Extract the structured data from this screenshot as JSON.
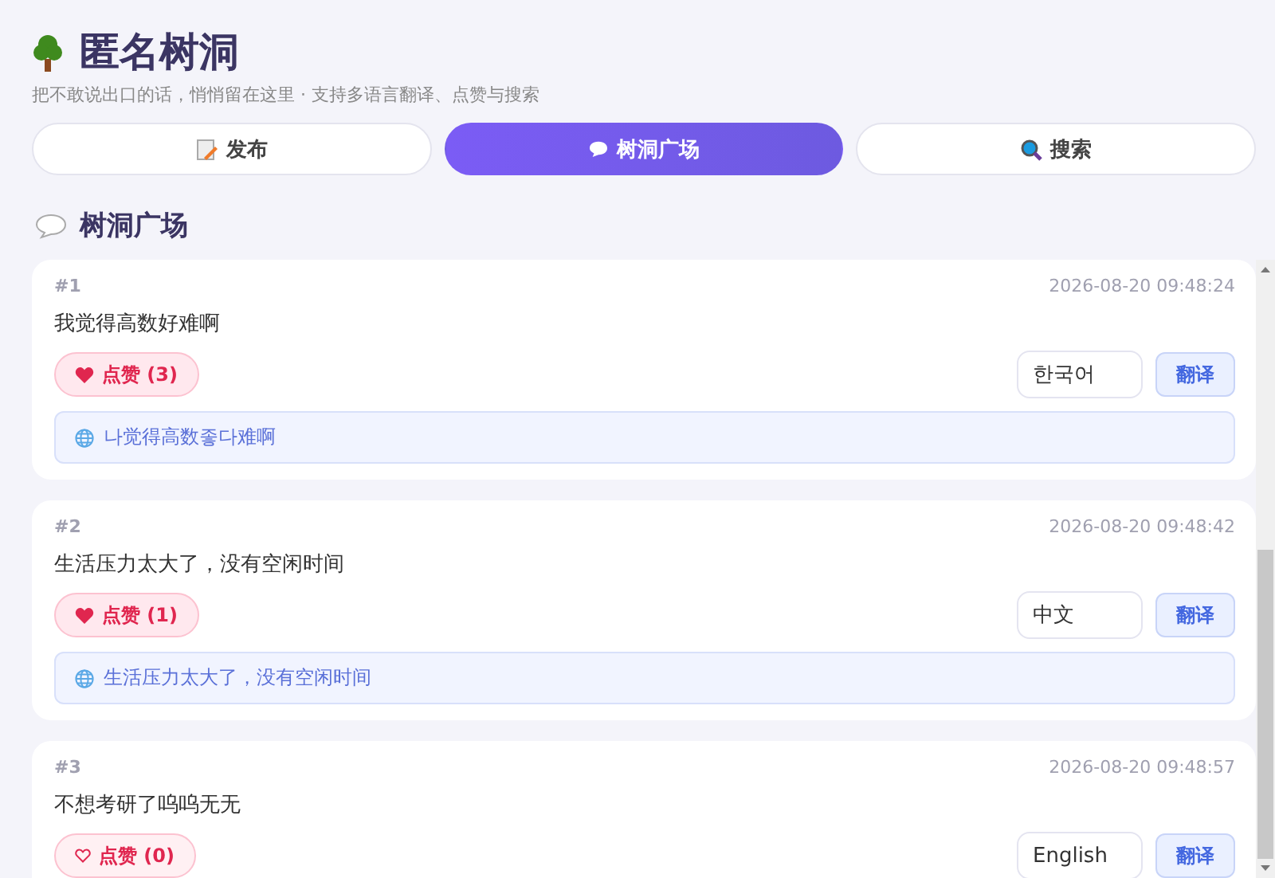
{
  "header": {
    "title": "匿名树洞",
    "subtitle": "把不敢说出口的话，悄悄留在这里 · 支持多语言翻译、点赞与搜索"
  },
  "tabs": [
    {
      "label": "发布",
      "kind": "memo",
      "selected": false
    },
    {
      "label": "树洞广场",
      "kind": "speech",
      "selected": true
    },
    {
      "label": "搜索",
      "kind": "search",
      "selected": false
    }
  ],
  "section": {
    "title": "树洞广场"
  },
  "posts": [
    {
      "number": "#1",
      "time": "2026-08-20 09:48:24",
      "text": "我觉得高数好难啊",
      "liked": true,
      "like_label": "点赞 (3)",
      "language": "한국어",
      "translate_label": "翻译",
      "translation": "나觉得高数좋다难啊"
    },
    {
      "number": "#2",
      "time": "2026-08-20 09:48:42",
      "text": "生活压力太大了，没有空闲时间",
      "liked": true,
      "like_label": "点赞 (1)",
      "language": "中文",
      "translate_label": "翻译",
      "translation": "生活压力太大了，没有空闲时间"
    },
    {
      "number": "#3",
      "time": "2026-08-20 09:48:57",
      "text": "不想考研了呜呜无无",
      "liked": false,
      "like_label": "点赞 (0)",
      "language": "English",
      "translate_label": "翻译"
    }
  ]
}
